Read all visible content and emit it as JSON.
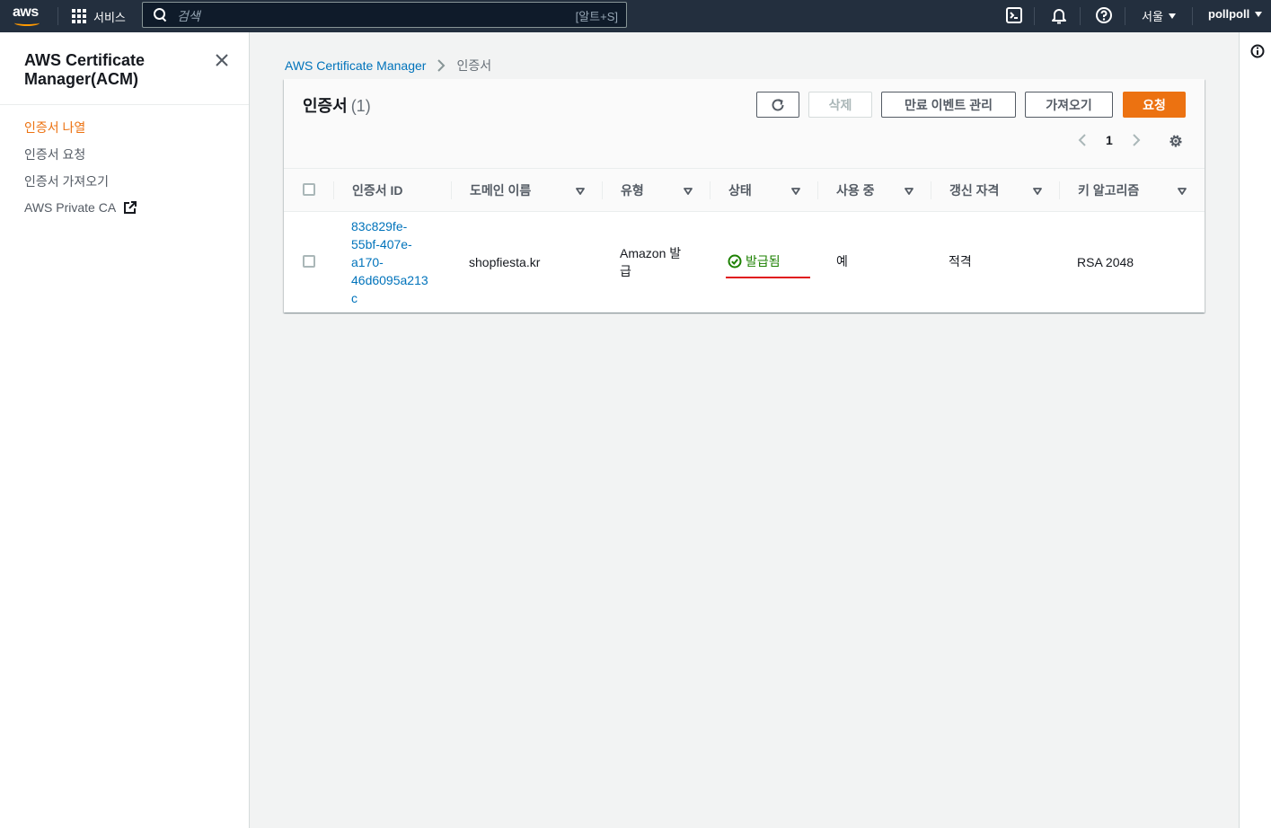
{
  "topnav": {
    "logo_text": "aws",
    "services_label": "서비스",
    "search_placeholder": "검색",
    "search_shortcut": "[알트+S]",
    "region": "서울",
    "account": "pollpoll",
    "icons": [
      "cloudshell-icon",
      "bell-icon",
      "help-icon"
    ]
  },
  "sidebar": {
    "title": "AWS Certificate Manager(ACM)",
    "items": [
      {
        "label": "인증서 나열",
        "active": true
      },
      {
        "label": "인증서 요청",
        "active": false
      },
      {
        "label": "인증서 가져오기",
        "active": false
      },
      {
        "label": "AWS Private CA",
        "active": false,
        "external": true
      }
    ]
  },
  "breadcrumb": {
    "root": "AWS Certificate Manager",
    "current": "인증서"
  },
  "panel": {
    "title": "인증서",
    "count": "(1)",
    "buttons": {
      "delete": "삭제",
      "manage_expiry": "만료 이벤트 관리",
      "import": "가져오기",
      "request": "요청"
    },
    "page": "1"
  },
  "table": {
    "columns": [
      "인증서 ID",
      "도메인 이름",
      "유형",
      "상태",
      "사용 중",
      "갱신 자격",
      "키 알고리즘"
    ],
    "rows": [
      {
        "cert_id_lines": [
          "83c829fe-",
          "55bf-407e-",
          "a170-",
          "46d6095a213",
          "c"
        ],
        "domain": "shopfiesta.kr",
        "type_lines": [
          "Amazon 발",
          "급"
        ],
        "status": "발급됨",
        "in_use": "예",
        "renewal": "적격",
        "key_algorithm": "RSA 2048"
      }
    ]
  },
  "colors": {
    "nav_bg": "#232f3e",
    "accent": "#ec7211",
    "link": "#0073bb",
    "success": "#1d8102",
    "annotation": "#e0141b"
  }
}
